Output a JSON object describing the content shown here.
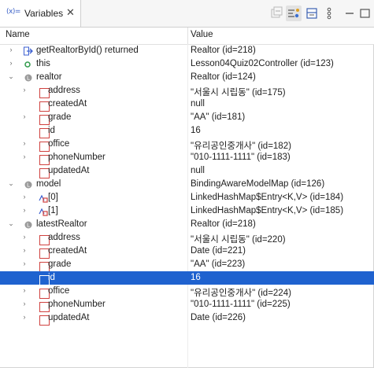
{
  "window": {
    "tab_icon": "(x)=",
    "tab_label": "Variables",
    "tab_close": "✕"
  },
  "toolbar": {
    "buttons": [
      "collapse-all-icon",
      "show-type-names-icon",
      "layout-icon",
      "view-menu-icon"
    ]
  },
  "columns": {
    "name": "Name",
    "value": "Value"
  },
  "rows": [
    {
      "level": 0,
      "expander": "›",
      "icon": "return-arrow-icon",
      "name": "getRealtorById() returned",
      "value": "Realtor  (id=218)"
    },
    {
      "level": 0,
      "expander": "›",
      "icon": "this-dot-icon",
      "name": "this",
      "value": "Lesson04Quiz02Controller  (id=123)"
    },
    {
      "level": 0,
      "expander": "⌄",
      "icon": "local-var-icon",
      "name": "realtor",
      "value": "Realtor  (id=124)"
    },
    {
      "level": 1,
      "expander": "›",
      "icon": "field-icon",
      "name": "address",
      "value": "\"서울시 시립동\" (id=175)"
    },
    {
      "level": 1,
      "expander": "",
      "icon": "field-icon",
      "name": "createdAt",
      "value": "null"
    },
    {
      "level": 1,
      "expander": "›",
      "icon": "field-icon",
      "name": "grade",
      "value": "\"AA\" (id=181)"
    },
    {
      "level": 1,
      "expander": "",
      "icon": "field-icon",
      "name": "id",
      "value": "16"
    },
    {
      "level": 1,
      "expander": "›",
      "icon": "field-icon",
      "name": "office",
      "value": "\"유리공인중개사\" (id=182)"
    },
    {
      "level": 1,
      "expander": "›",
      "icon": "field-icon",
      "name": "phoneNumber",
      "value": "\"010-1111-1111\" (id=183)"
    },
    {
      "level": 1,
      "expander": "",
      "icon": "field-icon",
      "name": "updatedAt",
      "value": "null"
    },
    {
      "level": 0,
      "expander": "⌄",
      "icon": "local-var-icon",
      "name": "model",
      "value": "BindingAwareModelMap  (id=126)"
    },
    {
      "level": 1,
      "expander": "›",
      "icon": "map-entry-icon",
      "name": "[0]",
      "value": "LinkedHashMap$Entry<K,V>  (id=184)"
    },
    {
      "level": 1,
      "expander": "›",
      "icon": "map-entry-icon",
      "name": "[1]",
      "value": "LinkedHashMap$Entry<K,V>  (id=185)"
    },
    {
      "level": 0,
      "expander": "⌄",
      "icon": "local-var-icon",
      "name": "latestRealtor",
      "value": "Realtor  (id=218)"
    },
    {
      "level": 1,
      "expander": "›",
      "icon": "field-icon",
      "name": "address",
      "value": "\"서울시 시립동\" (id=220)"
    },
    {
      "level": 1,
      "expander": "›",
      "icon": "field-icon",
      "name": "createdAt",
      "value": "Date  (id=221)"
    },
    {
      "level": 1,
      "expander": "›",
      "icon": "field-icon",
      "name": "grade",
      "value": "\"AA\" (id=223)"
    },
    {
      "level": 1,
      "expander": "",
      "icon": "field-icon",
      "name": "id",
      "value": "16",
      "selected": true
    },
    {
      "level": 1,
      "expander": "›",
      "icon": "field-icon",
      "name": "office",
      "value": "\"유리공인중개사\" (id=224)"
    },
    {
      "level": 1,
      "expander": "›",
      "icon": "field-icon",
      "name": "phoneNumber",
      "value": "\"010-1111-1111\" (id=225)"
    },
    {
      "level": 1,
      "expander": "›",
      "icon": "field-icon",
      "name": "updatedAt",
      "value": "Date  (id=226)"
    }
  ],
  "colors": {
    "selection": "#1f62cf",
    "field_icon": "#d0413f",
    "local_icon": "#8a8a8a",
    "this_icon": "#2f9a4a",
    "return_icon": "#3b5fd0"
  }
}
